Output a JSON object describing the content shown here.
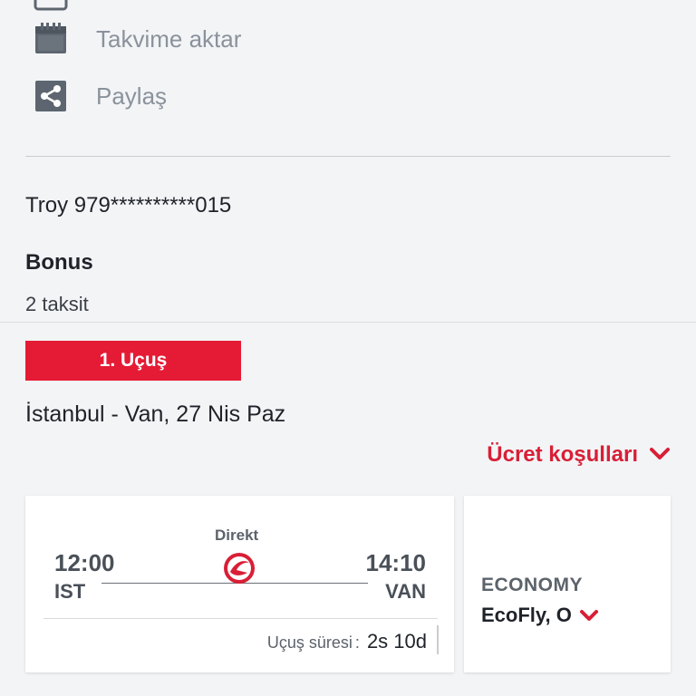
{
  "actions": [
    {
      "icon": "calendar-partial-icon",
      "label": ""
    },
    {
      "icon": "calendar-icon",
      "label": "Takvime aktar"
    },
    {
      "icon": "share-icon",
      "label": "Paylaş"
    }
  ],
  "payment": {
    "card": "Troy 979**********015",
    "bonus_label": "Bonus",
    "installments": "2 taksit"
  },
  "flight": {
    "badge": "1. Uçuş",
    "route_date": "İstanbul - Van, 27 Nis Paz",
    "fare_conditions": "Ücret koşulları",
    "direct_label": "Direkt",
    "departure_time": "12:00",
    "departure_code": "IST",
    "arrival_time": "14:10",
    "arrival_code": "VAN",
    "duration_label": "Uçuş süresi",
    "duration_value": "2s 10d",
    "cabin": "ECONOMY",
    "brand": "EcoFly, O"
  },
  "colors": {
    "accent": "#e51b35",
    "link": "#d81f36",
    "icon": "#5d6670"
  }
}
